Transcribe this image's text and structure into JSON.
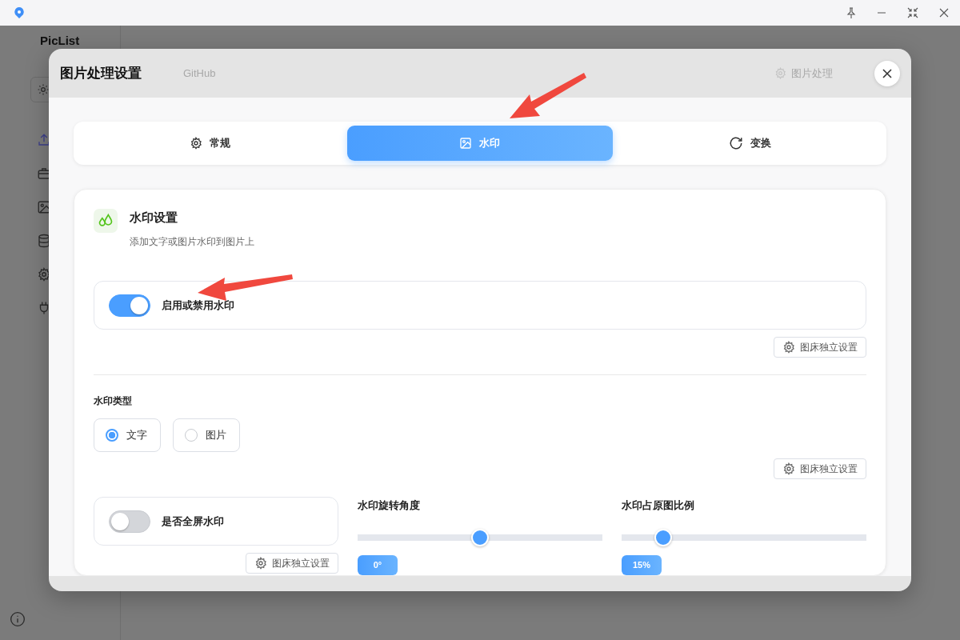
{
  "app": {
    "name": "PicList"
  },
  "backdrop": {
    "uploader_name": "GitHub",
    "action": "图片处理"
  },
  "dialog": {
    "title": "图片处理设置",
    "tabs": [
      {
        "kind": "general",
        "label": "常规",
        "selected": false
      },
      {
        "kind": "watermark",
        "label": "水印",
        "selected": true
      },
      {
        "kind": "transform",
        "label": "变换",
        "selected": false
      }
    ],
    "section": {
      "title": "水印设置",
      "subtitle": "添加文字或图片水印到图片上"
    },
    "enable": {
      "label": "启用或禁用水印",
      "on": true,
      "settings_button": "图床独立设置"
    },
    "type": {
      "label": "水印类型",
      "options": [
        {
          "label": "文字",
          "selected": true
        },
        {
          "label": "图片",
          "selected": false
        }
      ],
      "settings_button": "图床独立设置"
    },
    "fullscreen": {
      "label": "是否全屏水印",
      "on": false,
      "settings_button": "图床独立设置"
    },
    "sliders": [
      {
        "label": "水印旋转角度",
        "level": 0.5,
        "reading": "0°"
      },
      {
        "label": "水印占原图比例",
        "level": 0.17,
        "reading": "15%"
      }
    ]
  }
}
